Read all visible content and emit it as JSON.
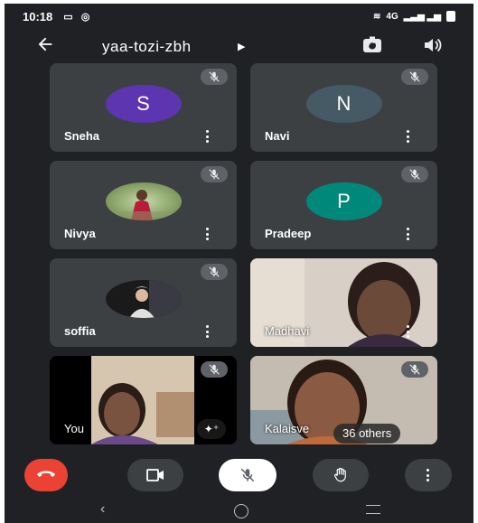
{
  "status_bar": {
    "time": "10:18",
    "network": "4G"
  },
  "meeting": {
    "code": "yaa-tozi-zbh"
  },
  "participants": [
    {
      "name": "Sneha",
      "initial": "S",
      "avatar_color": "#5e35b1"
    },
    {
      "name": "Navi",
      "initial": "N",
      "avatar_color": "#455a64"
    },
    {
      "name": "Nivya",
      "initial": "",
      "avatar_color": ""
    },
    {
      "name": "Pradeep",
      "initial": "P",
      "avatar_color": "#00897b"
    },
    {
      "name": "soffia",
      "initial": "",
      "avatar_color": ""
    },
    {
      "name": "Madhavi",
      "initial": "",
      "avatar_color": ""
    },
    {
      "name": "You",
      "initial": "",
      "avatar_color": ""
    },
    {
      "name": "Kalaisve",
      "initial": "",
      "avatar_color": ""
    }
  ],
  "others_chip": "36 others",
  "colors": {
    "background": "#202124",
    "tile": "#3c4043",
    "end_call": "#ea4335",
    "control": "#3c4043",
    "mic_button": "#ffffff"
  },
  "icons": [
    "arrow-left-icon",
    "caret-right-icon",
    "switch-camera-icon",
    "speaker-icon",
    "mic-off-icon",
    "more-vert-icon",
    "sparkle-effects-icon",
    "end-call-icon",
    "video-camera-icon",
    "raise-hand-icon",
    "back-nav-icon",
    "home-nav-icon",
    "recents-nav-icon"
  ]
}
